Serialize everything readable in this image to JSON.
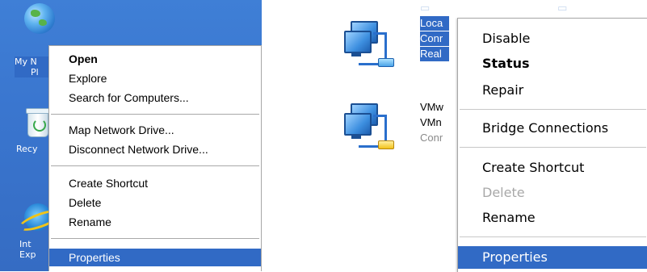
{
  "desktop": {
    "icons": [
      {
        "label_line1": "My N",
        "label_line2": "Pl",
        "icon": "network-places-icon"
      },
      {
        "label": "Recy",
        "icon": "recycle-bin-icon"
      },
      {
        "label_line1": "Int",
        "label_line2": "Exp",
        "icon": "internet-explorer-icon"
      }
    ]
  },
  "menu_left": {
    "items": [
      {
        "label": "Open",
        "style": "bold"
      },
      {
        "label": "Explore"
      },
      {
        "label": "Search for Computers..."
      },
      {
        "label": "Map Network Drive..."
      },
      {
        "label": "Disconnect Network Drive..."
      },
      {
        "label": "Create Shortcut"
      },
      {
        "label": "Delete"
      },
      {
        "label": "Rename"
      },
      {
        "label": "Properties",
        "state": "highlighted"
      }
    ]
  },
  "connections": [
    {
      "line1": "Loca",
      "line2": "Conr",
      "line3": "Real",
      "state": "selected",
      "icon": "network-connection-icon"
    },
    {
      "line1": "VMw",
      "line2": "VMn",
      "line3": "Conr",
      "state": "normal",
      "icon": "network-connection-icon"
    }
  ],
  "menu_right": {
    "items": [
      {
        "label": "Disable"
      },
      {
        "label": "Status",
        "style": "bold"
      },
      {
        "label": "Repair"
      },
      {
        "label": "Bridge Connections"
      },
      {
        "label": "Create Shortcut"
      },
      {
        "label": "Delete",
        "state": "disabled"
      },
      {
        "label": "Rename"
      },
      {
        "label": "Properties",
        "state": "highlighted"
      }
    ]
  },
  "colors": {
    "desktop_blue": "#3a76cf",
    "highlight": "#316ac5",
    "disabled_text": "#a8a8a8"
  }
}
